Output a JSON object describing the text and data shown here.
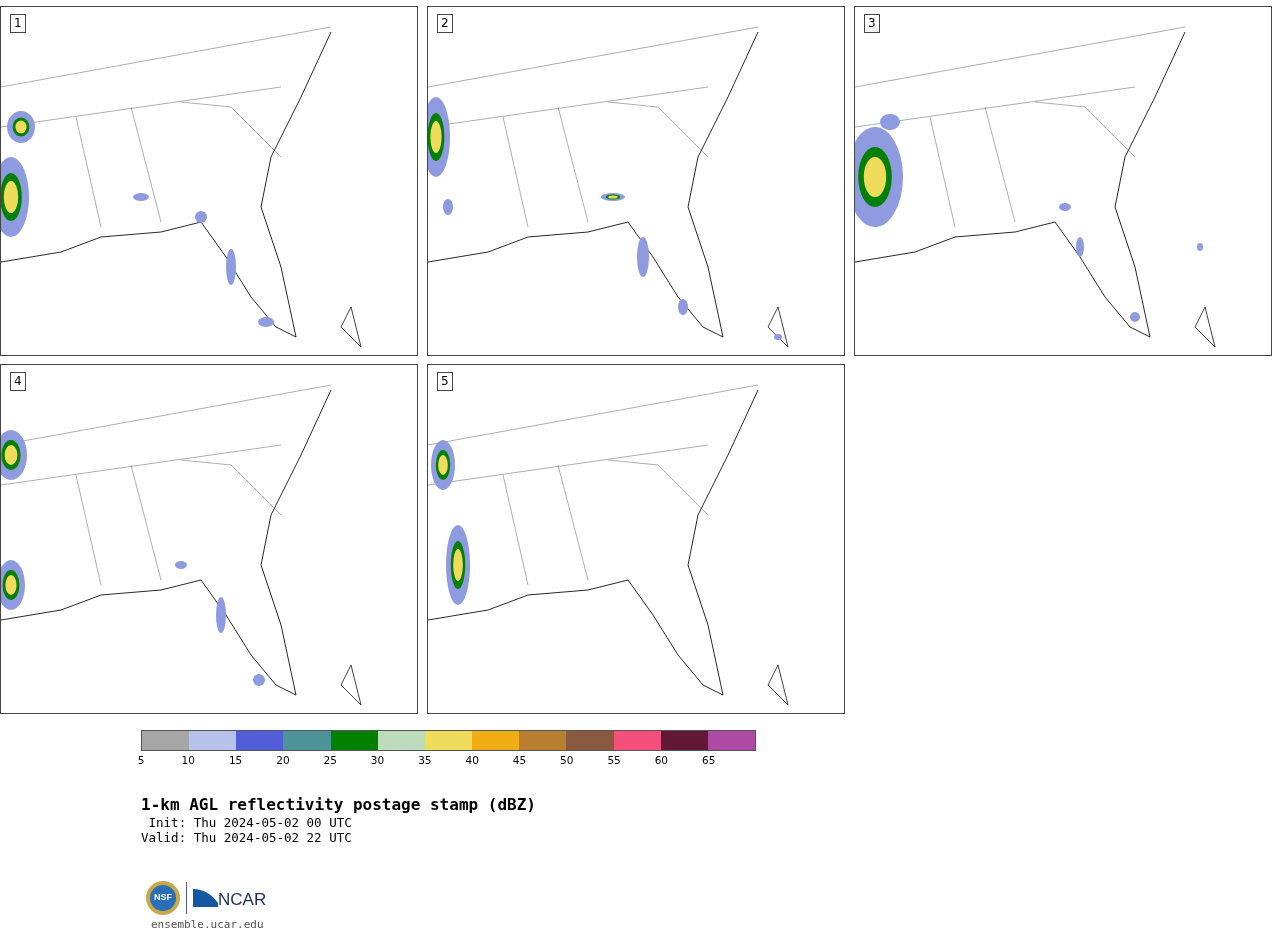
{
  "panels": [
    {
      "label": "1"
    },
    {
      "label": "2"
    },
    {
      "label": "3"
    },
    {
      "label": "4"
    },
    {
      "label": "5"
    }
  ],
  "colorbar": {
    "segments": [
      {
        "color": "#a6a6a6",
        "tick": "5"
      },
      {
        "color": "#b7c2eb",
        "tick": "10"
      },
      {
        "color": "#525ed8",
        "tick": "15"
      },
      {
        "color": "#4e9399",
        "tick": "20"
      },
      {
        "color": "#008000",
        "tick": "25"
      },
      {
        "color": "#bddcbc",
        "tick": "30"
      },
      {
        "color": "#f0dc5b",
        "tick": "35"
      },
      {
        "color": "#f0ad16",
        "tick": "40"
      },
      {
        "color": "#b97f31",
        "tick": "45"
      },
      {
        "color": "#8a5a40",
        "tick": "50"
      },
      {
        "color": "#f4507c",
        "tick": "55"
      },
      {
        "color": "#611835",
        "tick": "60"
      },
      {
        "color": "#ac4aa4",
        "tick": "65"
      }
    ]
  },
  "title": "1-km AGL reflectivity postage stamp (dBZ)",
  "init": " Init: Thu 2024-05-02 00 UTC",
  "valid": "Valid: Thu 2024-05-02 22 UTC",
  "logo": {
    "seal_text": "NSF",
    "wordmark": "NCAR"
  },
  "footer": "ensemble.ucar.edu"
}
